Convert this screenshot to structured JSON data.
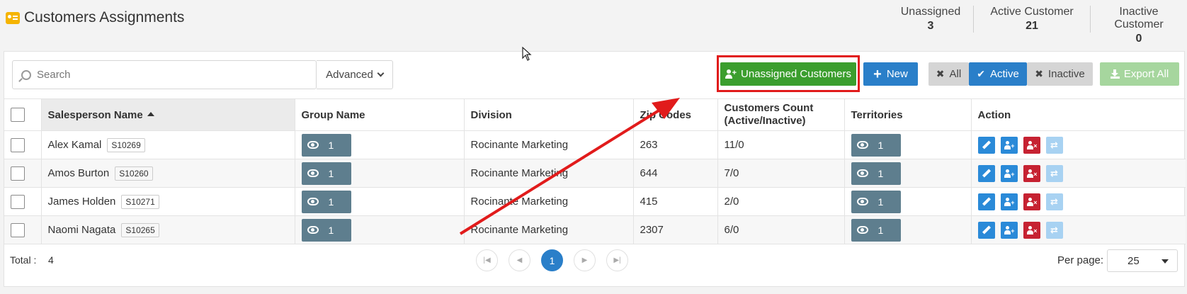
{
  "header": {
    "title": "Customers Assignments",
    "stats": [
      {
        "label": "Unassigned",
        "value": "3"
      },
      {
        "label": "Active Customer",
        "value": "21"
      },
      {
        "label": "Inactive Customer",
        "value": "0"
      }
    ]
  },
  "toolbar": {
    "search_placeholder": "Search",
    "advanced_label": "Advanced",
    "unassigned_label": "Unassigned Customers",
    "new_label": "New",
    "filter_all": "All",
    "filter_active": "Active",
    "filter_inactive": "Inactive",
    "export_label": "Export All"
  },
  "table": {
    "columns": [
      "Salesperson Name",
      "Group Name",
      "Division",
      "Zip Codes",
      "Customers Count (Active/Inactive)",
      "Territories",
      "Action"
    ],
    "rows": [
      {
        "name": "Alex Kamal",
        "code": "S10269",
        "group": "1",
        "division": "Rocinante Marketing",
        "zip": "263",
        "count": "11/0",
        "territories": "1"
      },
      {
        "name": "Amos Burton",
        "code": "S10260",
        "group": "1",
        "division": "Rocinante Marketing",
        "zip": "644",
        "count": "7/0",
        "territories": "1"
      },
      {
        "name": "James Holden",
        "code": "S10271",
        "group": "1",
        "division": "Rocinante Marketing",
        "zip": "415",
        "count": "2/0",
        "territories": "1"
      },
      {
        "name": "Naomi Nagata",
        "code": "S10265",
        "group": "1",
        "division": "Rocinante Marketing",
        "zip": "2307",
        "count": "6/0",
        "territories": "1"
      }
    ]
  },
  "footer": {
    "total_label": "Total :",
    "total_value": "4",
    "current_page": "1",
    "per_page_label": "Per page:",
    "per_page_value": "25"
  },
  "colors": {
    "primary": "#2a7fc9",
    "success": "#3b9e2e",
    "danger": "#c62232",
    "annotation": "#e11b1b"
  }
}
